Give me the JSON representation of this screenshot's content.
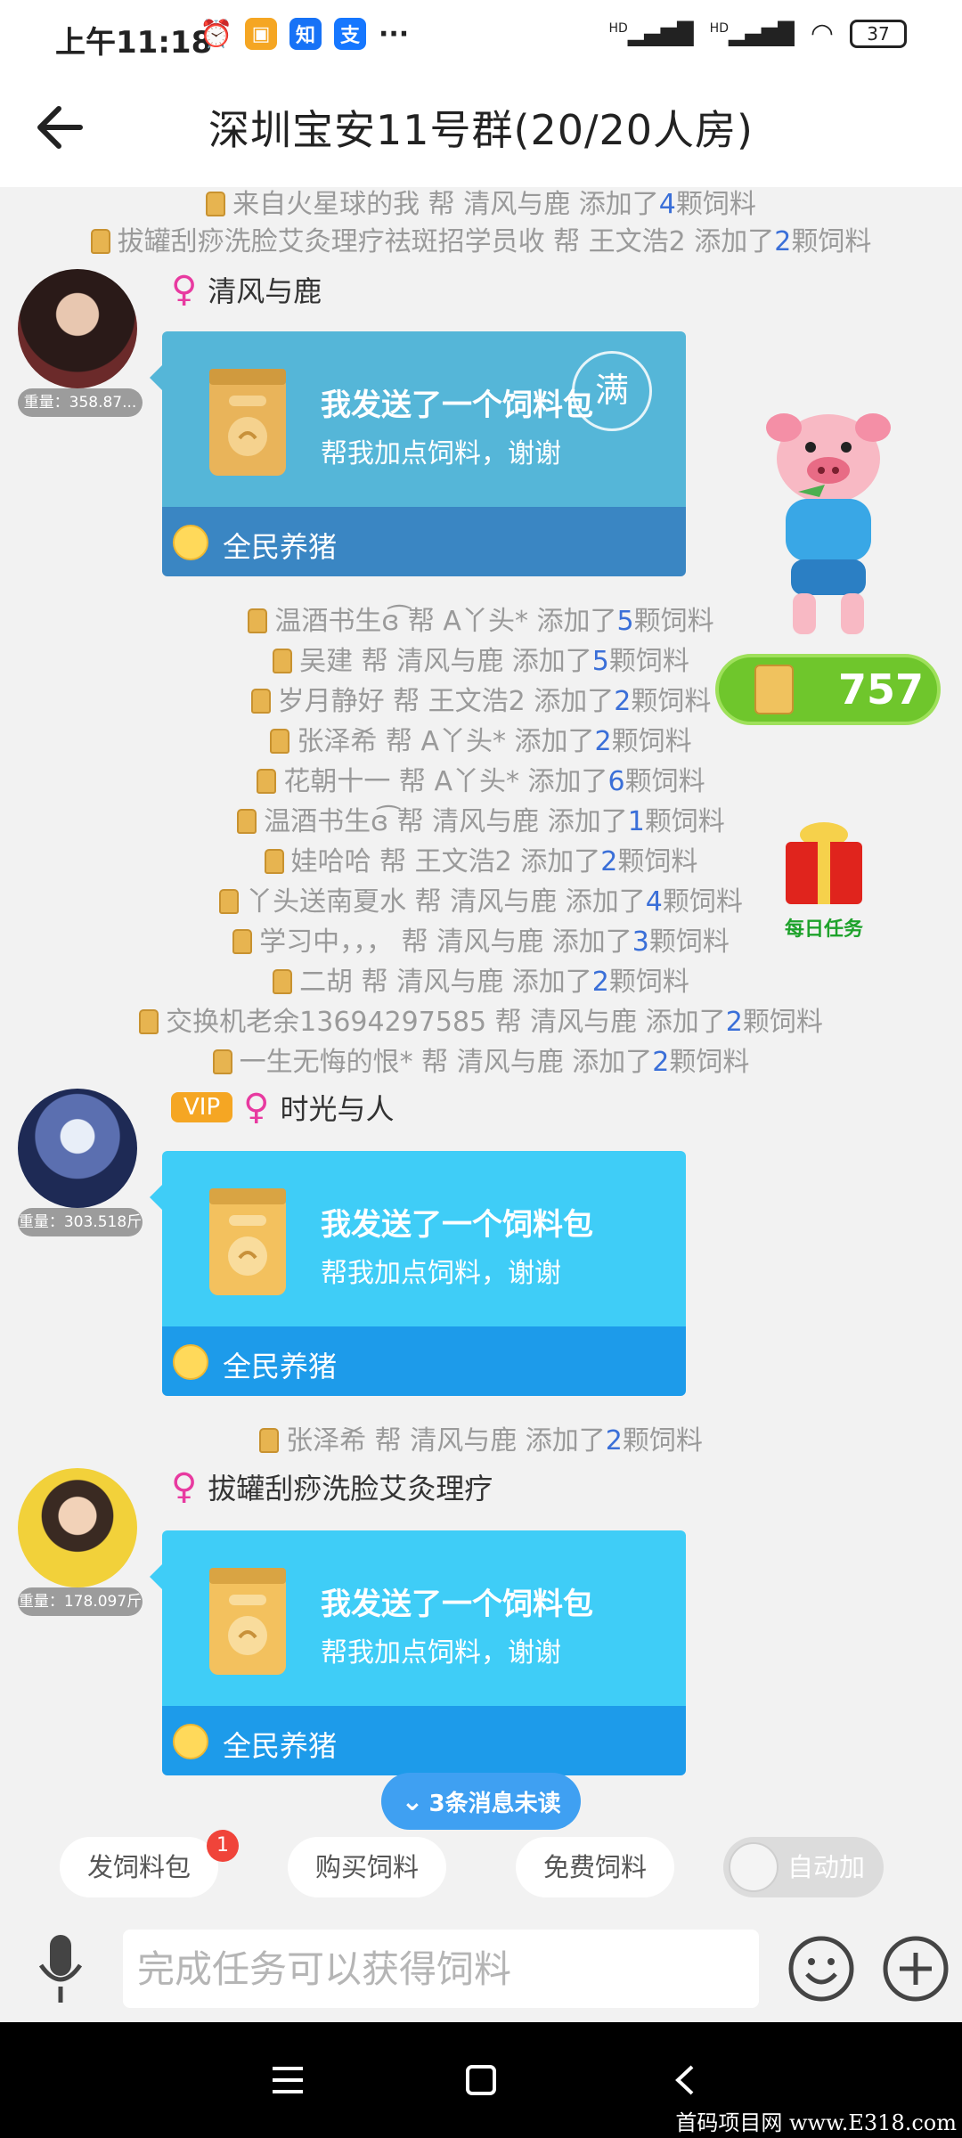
{
  "status_bar": {
    "time": "上午11:18",
    "app_icons": [
      {
        "name": "alarm-icon",
        "glyph": "⏰",
        "color": "#333333"
      },
      {
        "name": "message-app-icon",
        "glyph": "▣",
        "color": "#f5a623"
      },
      {
        "name": "zhihu-icon",
        "glyph": "知",
        "color": "#1772f6"
      },
      {
        "name": "alipay-icon",
        "glyph": "支",
        "color": "#1677ff"
      }
    ],
    "more": "···",
    "signal1": "HD",
    "signal2": "HD",
    "battery": "37"
  },
  "header": {
    "title": "深圳宝安11号群(20/20人房)"
  },
  "system_lines": [
    {
      "pre": "来自火星球的我 帮 清风与鹿 添加了",
      "num": "4",
      "post": "颗饲料"
    },
    {
      "pre": "拔罐刮痧洗脸艾灸理疗祛斑招学员收 帮 王文浩2 添加了",
      "num": "2",
      "post": "颗饲料"
    },
    {
      "pre": "温酒书生ɞ͡ 帮 A丫头* 添加了",
      "num": "5",
      "post": "颗饲料"
    },
    {
      "pre": "吴建 帮 清风与鹿 添加了",
      "num": "5",
      "post": "颗饲料"
    },
    {
      "pre": "岁月静好 帮 王文浩2 添加了",
      "num": "2",
      "post": "颗饲料"
    },
    {
      "pre": "张泽希 帮 A丫头* 添加了",
      "num": "2",
      "post": "颗饲料"
    },
    {
      "pre": "花朝十一 帮 A丫头* 添加了",
      "num": "6",
      "post": "颗饲料"
    },
    {
      "pre": "温酒书生ɞ͡ 帮 清风与鹿 添加了",
      "num": "1",
      "post": "颗饲料"
    },
    {
      "pre": "娃哈哈 帮 王文浩2 添加了",
      "num": "2",
      "post": "颗饲料"
    },
    {
      "pre": "丫头送南夏水 帮 清风与鹿 添加了",
      "num": "4",
      "post": "颗饲料"
    },
    {
      "pre": "学习中，，， 帮 清风与鹿 添加了",
      "num": "3",
      "post": "颗饲料"
    },
    {
      "pre": "二胡 帮 清风与鹿 添加了",
      "num": "2",
      "post": "颗饲料"
    },
    {
      "pre": "交换机老余13694297585 帮 清风与鹿 添加了",
      "num": "2",
      "post": "颗饲料"
    },
    {
      "pre": "一生无悔的恨* 帮 清风与鹿 添加了",
      "num": "2",
      "post": "颗饲料"
    },
    {
      "pre": "张泽希 帮 清风与鹿 添加了",
      "num": "2",
      "post": "颗饲料"
    }
  ],
  "messages": [
    {
      "username": "清风与鹿",
      "weight": "重量：358.87...",
      "vip": "",
      "card_title": "我发送了一个饲料包",
      "card_sub": "帮我加点饲料，谢谢",
      "card_footer": "全民养猪",
      "stamp": "满",
      "top_color": "#55b6d8",
      "bottom_color": "#3a86c3"
    },
    {
      "username": "时光与人",
      "weight": "重量：303.518斤",
      "vip": "VIP",
      "card_title": "我发送了一个饲料包",
      "card_sub": "帮我加点饲料，谢谢",
      "card_footer": "全民养猪",
      "stamp": "",
      "top_color": "#3fcdf7",
      "bottom_color": "#1d9bea"
    },
    {
      "username": "拔罐刮痧洗脸艾灸理疗",
      "weight": "重量：178.097斤",
      "vip": "",
      "card_title": "我发送了一个饲料包",
      "card_sub": "帮我加点饲料，谢谢",
      "card_footer": "全民养猪",
      "stamp": "",
      "top_color": "#3fcdf7",
      "bottom_color": "#1d9bea"
    }
  ],
  "feed_counter": "757",
  "daily_task_label": "每日任务",
  "unread": "3条消息未读",
  "chips": {
    "send_feed": "发饲料包",
    "send_feed_badge": "1",
    "buy_feed": "购买饲料",
    "free_feed": "免费饲料",
    "auto_add": "自动加"
  },
  "input": {
    "placeholder": "完成任务可以获得饲料"
  },
  "watermark": "首码项目网 www.E318.com",
  "colors": {
    "accent_blue": "#3fa0f2",
    "female": "#e83aa0",
    "green_button": "#6fc62c"
  }
}
